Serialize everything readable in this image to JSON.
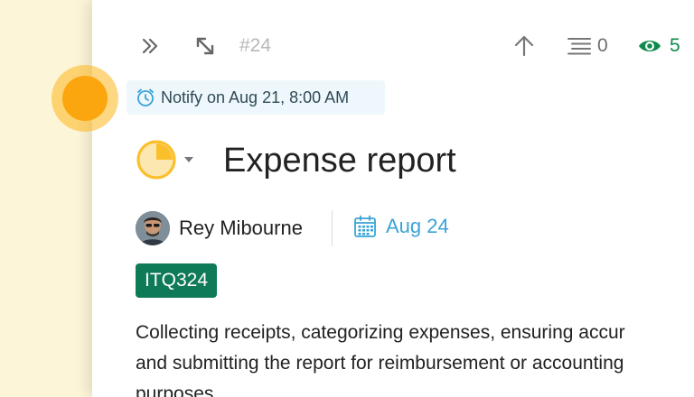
{
  "toolbar": {
    "task_id": "#24",
    "subtasks_count": "0",
    "watchers_count": "5",
    "icons": {
      "expand": "double-chevron-right-icon",
      "resize": "diagonal-arrows-icon",
      "move_up": "arrow-up-icon",
      "subtasks": "list-lines-icon",
      "watchers": "eye-icon"
    }
  },
  "reminder": {
    "text": "Notify on Aug 21, 8:00 AM",
    "icon": "alarm-clock-icon"
  },
  "task": {
    "status_icon": "pie-status-icon",
    "title": "Expense report",
    "assignee": "Rey Mibourne",
    "due_date": "Aug 24",
    "tag": "ITQ324",
    "description_lines": [
      "Collecting receipts, categorizing expenses, ensuring accur",
      "and submitting the report for reimbursement or accounting",
      "purposes."
    ]
  },
  "colors": {
    "accent_green": "#0e7a57",
    "watch_green": "#0e8a4c",
    "date_blue": "#3aa3d6",
    "status_yellow": "#fbbf2c",
    "indicator_orange": "#fba60e"
  }
}
